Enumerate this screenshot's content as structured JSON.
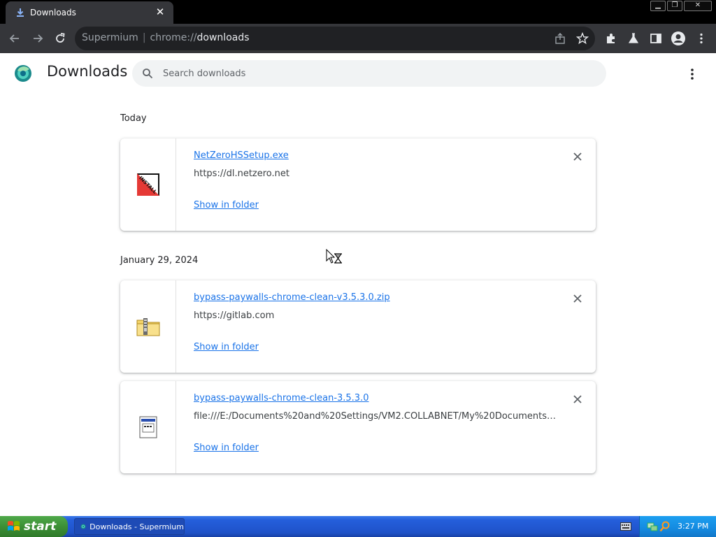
{
  "tab": {
    "title": "Downloads",
    "icon": "download-icon"
  },
  "window_controls": {
    "minimize": "minimize-icon",
    "restore": "restore-icon",
    "close": "close-icon"
  },
  "omnibox": {
    "site_name": "Supermium",
    "scheme": "chrome://",
    "path": "downloads"
  },
  "page": {
    "title": "Downloads",
    "search_placeholder": "Search downloads"
  },
  "sections": [
    {
      "date": "Today",
      "items": [
        {
          "file_name": "NetZeroHSSetup.exe",
          "url": "https://dl.netzero.net",
          "action": "Show in folder",
          "icon": "installer-icon"
        }
      ]
    },
    {
      "date": "January 29, 2024",
      "items": [
        {
          "file_name": "bypass-paywalls-chrome-clean-v3.5.3.0.zip",
          "url": "https://gitlab.com",
          "action": "Show in folder",
          "icon": "zip-folder-icon"
        },
        {
          "file_name": "bypass-paywalls-chrome-clean-3.5.3.0",
          "url": "file:///E:/Documents%20and%20Settings/VM2.COLLABNET/My%20Documents/Down...",
          "action": "Show in folder",
          "icon": "generic-file-icon"
        }
      ]
    }
  ],
  "taskbar": {
    "start_label": "start",
    "task_label": "Downloads - Supermium",
    "clock": "3:27 PM"
  },
  "colors": {
    "link": "#1a73e8",
    "chrome_dark": "#35363a",
    "taskbar_blue": "#245edb",
    "start_green": "#3c8f35"
  }
}
